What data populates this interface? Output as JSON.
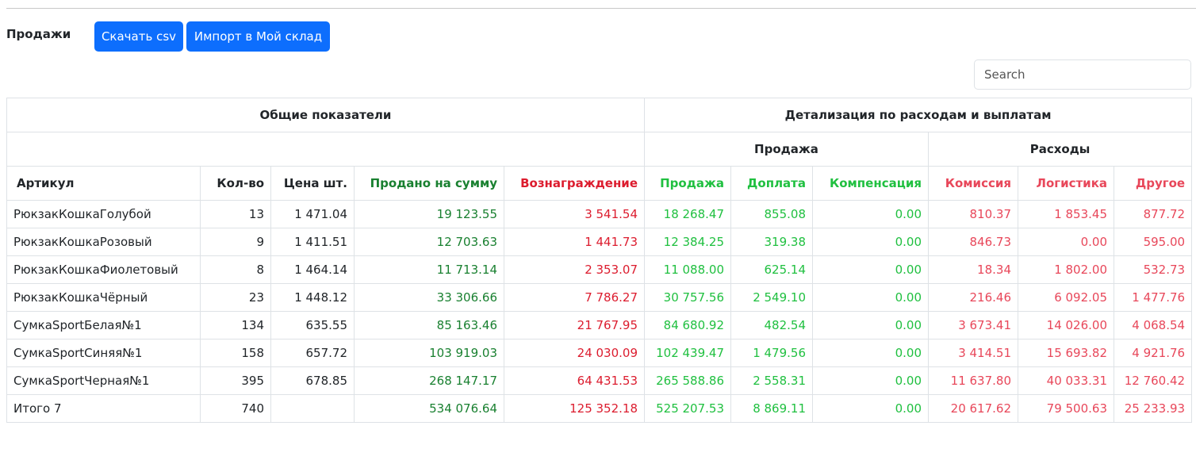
{
  "toolbar": {
    "title": "Продажи",
    "csv_label": "Скачать csv",
    "import_label": "Импорт в Мой склад"
  },
  "search": {
    "placeholder": "Search",
    "value": ""
  },
  "colors": {
    "primary": "#0d6efd",
    "revenue_green": "#198030",
    "reward_red": "#dc1c2e",
    "detail_green": "#20c040",
    "detail_red": "#e8475a"
  },
  "table": {
    "group_headers": {
      "general": "Общие показатели",
      "detail": "Детализация по расходам и выплатам",
      "sale": "Продажа",
      "expenses": "Расходы"
    },
    "columns": [
      "Артикул",
      "Кол-во",
      "Цена шт.",
      "Продано на сумму",
      "Вознаграждение",
      "Продажа",
      "Доплата",
      "Компенсация",
      "Комиссия",
      "Логистика",
      "Другое"
    ],
    "rows": [
      [
        "РюкзакКошкаГолубой",
        "13",
        "1 471.04",
        "19 123.55",
        "3 541.54",
        "18 268.47",
        "855.08",
        "0.00",
        "810.37",
        "1 853.45",
        "877.72"
      ],
      [
        "РюкзакКошкаРозовый",
        "9",
        "1 411.51",
        "12 703.63",
        "1 441.73",
        "12 384.25",
        "319.38",
        "0.00",
        "846.73",
        "0.00",
        "595.00"
      ],
      [
        "РюкзакКошкаФиолетовый",
        "8",
        "1 464.14",
        "11 713.14",
        "2 353.07",
        "11 088.00",
        "625.14",
        "0.00",
        "18.34",
        "1 802.00",
        "532.73"
      ],
      [
        "РюкзакКошкаЧёрный",
        "23",
        "1 448.12",
        "33 306.66",
        "7 786.27",
        "30 757.56",
        "2 549.10",
        "0.00",
        "216.46",
        "6 092.05",
        "1 477.76"
      ],
      [
        "СумкаSportБелая№1",
        "134",
        "635.55",
        "85 163.46",
        "21 767.95",
        "84 680.92",
        "482.54",
        "0.00",
        "3 673.41",
        "14 026.00",
        "4 068.54"
      ],
      [
        "СумкаSportСиняя№1",
        "158",
        "657.72",
        "103 919.03",
        "24 030.09",
        "102 439.47",
        "1 479.56",
        "0.00",
        "3 414.51",
        "15 693.82",
        "4 921.76"
      ],
      [
        "СумкаSportЧерная№1",
        "395",
        "678.85",
        "268 147.17",
        "64 431.53",
        "265 588.86",
        "2 558.31",
        "0.00",
        "11 637.80",
        "40 033.31",
        "12 760.42"
      ]
    ],
    "total": [
      "Итого 7",
      "740",
      "",
      "534 076.64",
      "125 352.18",
      "525 207.53",
      "8 869.11",
      "0.00",
      "20 617.62",
      "79 500.63",
      "25 233.93"
    ]
  }
}
